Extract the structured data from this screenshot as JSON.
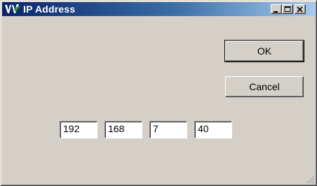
{
  "window": {
    "title": "IP Address"
  },
  "titlebar_buttons": [
    {
      "name": "minimize",
      "icon": "minimize-icon"
    },
    {
      "name": "maximize",
      "icon": "maximize-icon"
    },
    {
      "name": "close",
      "icon": "close-icon"
    }
  ],
  "buttons": {
    "ok_label": "OK",
    "cancel_label": "Cancel"
  },
  "ip_octets": [
    "192",
    "168",
    "7",
    "40"
  ],
  "colors": {
    "titlebar_start": "#0a246a",
    "titlebar_end": "#a6caf0",
    "face": "#d4d0c8"
  }
}
